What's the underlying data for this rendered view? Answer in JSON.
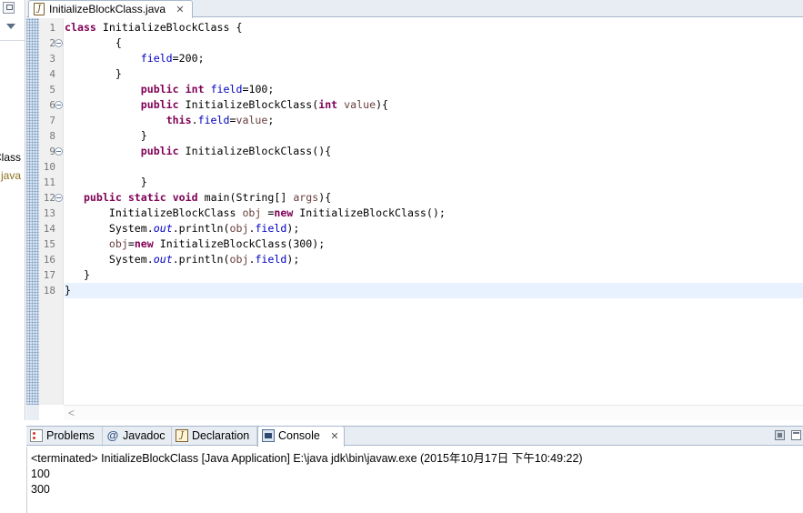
{
  "left_panel": {
    "cut_text_1": "Class",
    "cut_text_2": "java"
  },
  "editor_tab": {
    "title": "InitializeBlockClass.java",
    "close_glyph": "✕",
    "icon": "java-file-icon"
  },
  "code_lines": [
    {
      "n": "1",
      "fold": false,
      "text": "class InitializeBlockClass {"
    },
    {
      "n": "2",
      "fold": true,
      "text": "        {"
    },
    {
      "n": "3",
      "fold": false,
      "text": "            field=200;"
    },
    {
      "n": "4",
      "fold": false,
      "text": "        }"
    },
    {
      "n": "5",
      "fold": false,
      "text": "            public int field=100;"
    },
    {
      "n": "6",
      "fold": true,
      "text": "            public InitializeBlockClass(int value){"
    },
    {
      "n": "7",
      "fold": false,
      "text": "                this.field=value;"
    },
    {
      "n": "8",
      "fold": false,
      "text": "            }"
    },
    {
      "n": "9",
      "fold": true,
      "text": "            public InitializeBlockClass(){"
    },
    {
      "n": "10",
      "fold": false,
      "text": ""
    },
    {
      "n": "11",
      "fold": false,
      "text": "            }"
    },
    {
      "n": "12",
      "fold": true,
      "text": "   public static void main(String[] args){"
    },
    {
      "n": "13",
      "fold": false,
      "text": "       InitializeBlockClass obj =new InitializeBlockClass();"
    },
    {
      "n": "14",
      "fold": false,
      "text": "       System.out.println(obj.field);"
    },
    {
      "n": "15",
      "fold": false,
      "text": "       obj=new InitializeBlockClass(300);"
    },
    {
      "n": "16",
      "fold": false,
      "text": "       System.out.println(obj.field);"
    },
    {
      "n": "17",
      "fold": false,
      "text": "   }"
    },
    {
      "n": "18",
      "fold": false,
      "text": "}"
    }
  ],
  "current_line": "18",
  "view_tabs": [
    {
      "label": "Problems",
      "icon": "problems-icon",
      "active": false
    },
    {
      "label": "Javadoc",
      "icon": "javadoc-icon",
      "active": false
    },
    {
      "label": "Declaration",
      "icon": "declaration-icon",
      "active": false
    },
    {
      "label": "Console",
      "icon": "console-icon",
      "active": true
    }
  ],
  "javadoc_glyph": "@",
  "declaration_glyph": "J",
  "console": {
    "status": "<terminated> InitializeBlockClass [Java Application] E:\\java jdk\\bin\\javaw.exe (2015年10月17日 下午10:49:22)",
    "output": [
      "100",
      "300"
    ]
  },
  "colors": {
    "keyword": "#7f0055",
    "field": "#0000c0",
    "current_line_bg": "#e8f2fe",
    "tabbar_bg": "#e8edf3"
  }
}
